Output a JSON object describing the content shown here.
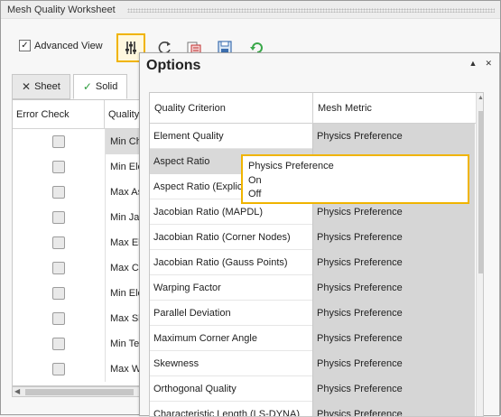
{
  "window": {
    "title": "Mesh Quality Worksheet"
  },
  "toolbar": {
    "advanced_view_label": "Advanced View",
    "advanced_view_checked": true,
    "advanced_view_check_glyph": "✓",
    "buttons": [
      {
        "icon": "options-sliders-icon",
        "selected": true
      },
      {
        "icon": "refresh-icon",
        "selected": false
      },
      {
        "icon": "export-icon",
        "selected": false
      },
      {
        "icon": "save-icon",
        "selected": false
      },
      {
        "icon": "update-icon",
        "selected": false
      }
    ],
    "accent_color": "#f0b400"
  },
  "tabs": [
    {
      "label": "Sheet",
      "icon": "close-x-icon",
      "glyph": "✕"
    },
    {
      "label": "Solid",
      "icon": "check-icon",
      "glyph": "✓",
      "active": true
    }
  ],
  "worksheet": {
    "columns": [
      "Error Check",
      "Quality"
    ],
    "rows": [
      {
        "criterion": "Min Ch",
        "highlighted": true
      },
      {
        "criterion": "Min Ele"
      },
      {
        "criterion": "Max As"
      },
      {
        "criterion": "Min Jac"
      },
      {
        "criterion": "Max Ele"
      },
      {
        "criterion": "Max Co"
      },
      {
        "criterion": "Min Ele"
      },
      {
        "criterion": "Max Sk"
      },
      {
        "criterion": "Min Te"
      },
      {
        "criterion": "Max W"
      }
    ]
  },
  "options_panel": {
    "title": "Options",
    "pin_glyph": "▲",
    "close_glyph": "✕",
    "columns": [
      "Quality Criterion",
      "Mesh Metric"
    ],
    "rows": [
      {
        "criterion": "Element Quality",
        "metric": "Physics Preference"
      },
      {
        "criterion": "Aspect Ratio",
        "metric": "",
        "selected": true
      },
      {
        "criterion": "Aspect Ratio (Explicit)",
        "metric": ""
      },
      {
        "criterion": "Jacobian Ratio (MAPDL)",
        "metric": "Physics Preference"
      },
      {
        "criterion": "Jacobian Ratio (Corner Nodes)",
        "metric": "Physics Preference"
      },
      {
        "criterion": "Jacobian Ratio (Gauss Points)",
        "metric": "Physics Preference"
      },
      {
        "criterion": "Warping Factor",
        "metric": "Physics Preference"
      },
      {
        "criterion": "Parallel Deviation",
        "metric": "Physics Preference"
      },
      {
        "criterion": "Maximum Corner Angle",
        "metric": "Physics Preference"
      },
      {
        "criterion": "Skewness",
        "metric": "Physics Preference"
      },
      {
        "criterion": "Orthogonal Quality",
        "metric": "Physics Preference"
      },
      {
        "criterion": "Characteristic Length (LS-DYNA)",
        "metric": "Physics Preference"
      }
    ],
    "dropdown_options": [
      "Physics Preference",
      "On",
      "Off"
    ]
  }
}
